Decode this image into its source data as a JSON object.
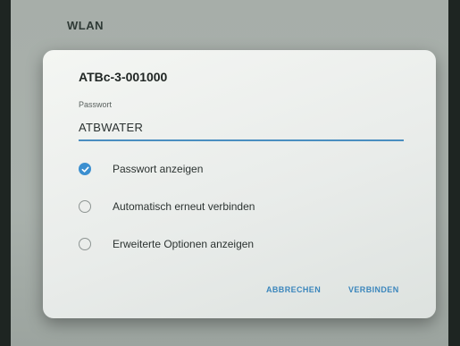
{
  "header": {
    "title": "WLAN"
  },
  "dialog": {
    "network_name": "ATBc-3-001000",
    "password_label": "Passwort",
    "password_value": "ATBWATER",
    "options": [
      {
        "label": "Passwort anzeigen",
        "checked": true
      },
      {
        "label": "Automatisch erneut verbinden",
        "checked": false
      },
      {
        "label": "Erweiterte Optionen anzeigen",
        "checked": false
      }
    ],
    "cancel_label": "ABBRECHEN",
    "connect_label": "VERBINDEN"
  },
  "colors": {
    "accent": "#3b8fd0",
    "dialog_bg": "#eef1ee",
    "backdrop": "#a9b1ac"
  },
  "icons": {
    "checked": "checkmark-icon",
    "unchecked": "radio-empty-icon"
  }
}
